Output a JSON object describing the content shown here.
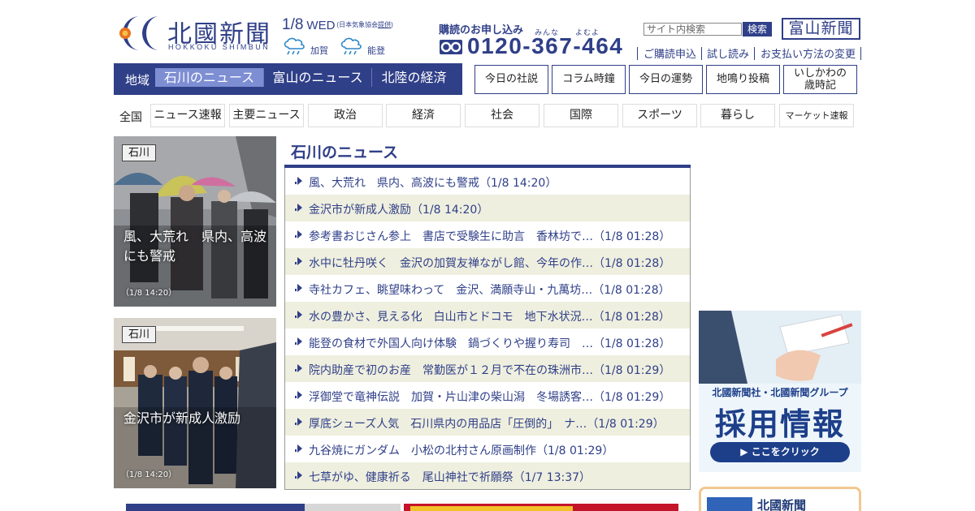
{
  "header": {
    "logo_text": "北國新聞",
    "logo_sub": "HOKKOKU SHIMBUN",
    "date": "1/8",
    "weekday": "WED",
    "weather_note_prefix": "(日本気象協会",
    "weather_note_link": "提供",
    "weather_note_suffix": ")",
    "weather": [
      {
        "area": "加賀",
        "icon": "rain-icon"
      },
      {
        "area": "能登",
        "icon": "rain-icon"
      }
    ],
    "subscribe_title": "購読のお申し込み",
    "phone_ruby": [
      "みんな",
      "よむよ"
    ],
    "phone": "0120-367-464",
    "search_placeholder": "サイト内検索",
    "search_button": "検索",
    "toyama_link": "富山新聞",
    "sub_links": [
      "ご購読申込",
      "試し読み",
      "お支払い方法の変更"
    ]
  },
  "region_nav": {
    "label": "地域",
    "tabs": [
      "石川のニュース",
      "富山のニュース",
      "北陸の経済"
    ],
    "active_index": 0
  },
  "header_buttons": [
    {
      "label": "今日の社説"
    },
    {
      "label": "コラム時鐘"
    },
    {
      "label": "今日の運勢"
    },
    {
      "label": "地鳴り投稿"
    },
    {
      "label_line1": "いしかわの",
      "label_line2": "歳時記"
    }
  ],
  "categories": {
    "all_label": "全国",
    "items": [
      "ニュース速報",
      "主要ニュース",
      "政治",
      "経済",
      "社会",
      "国際",
      "スポーツ",
      "暮らし",
      "マーケット速報"
    ]
  },
  "features": [
    {
      "tag": "石川",
      "caption": "風、大荒れ　県内、高波にも警戒",
      "time": "（1/8 14:20）"
    },
    {
      "tag": "石川",
      "caption": "金沢市が新成人激励",
      "time": "（1/8 14:20）"
    }
  ],
  "news": {
    "title": "石川のニュース",
    "items": [
      "風、大荒れ　県内、高波にも警戒（1/8 14:20）",
      "金沢市が新成人激励（1/8 14:20）",
      "参考書おじさん参上　書店で受験生に助言　香林坊で…（1/8 01:28）",
      "水中に牡丹咲く　金沢の加賀友禅ながし館、今年の作…（1/8 01:28）",
      "寺社カフェ、眺望味わって　金沢、満願寺山・九萬坊…（1/8 01:28）",
      "水の豊かさ、見える化　白山市とドコモ　地下水状況…（1/8 01:28）",
      "能登の食材で外国人向け体験　鍋づくりや握り寿司　…（1/8 01:28）",
      "院内助産で初のお産　常勤医が１２月で不在の珠洲市…（1/8 01:29）",
      "浮御堂で竜神伝説　加賀・片山津の柴山潟　冬場誘客…（1/8 01:29）",
      "厚底シューズ人気　石川県内の用品店「圧倒的」　ナ…（1/8 01:29）",
      "九谷焼にガンダム　小松の北村さん原画制作（1/8 01:29）",
      "七草がゆ、健康祈る　尾山神社で祈願祭（1/7 13:37）"
    ]
  },
  "sidebar": {
    "recruit_line1": "北國新聞社・北國新聞グループ",
    "recruit_line2": "採用情報",
    "recruit_button": "▶ ここをクリック",
    "app_name": "北國新聞"
  },
  "colors": {
    "brand": "#2f3f88",
    "active_tab": "#7e8ed3",
    "row_alt": "#efefdf",
    "recruit_blue": "#1d3f8a"
  }
}
